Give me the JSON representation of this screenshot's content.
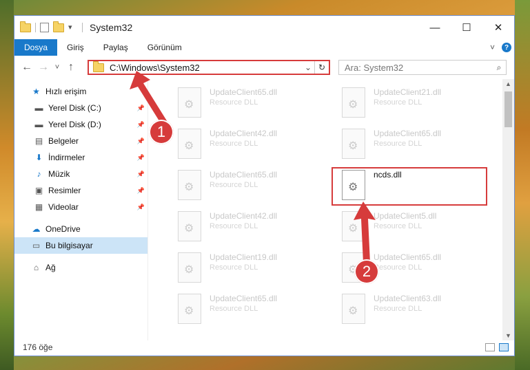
{
  "window": {
    "title": "System32",
    "controls": {
      "minimize": "—",
      "maximize": "☐",
      "close": "✕"
    }
  },
  "ribbon": {
    "tabs": [
      "Dosya",
      "Giriş",
      "Paylaş",
      "Görünüm"
    ],
    "active_tab": "Dosya"
  },
  "nav": {
    "back": "←",
    "forward": "→",
    "recent": "˅",
    "up": "↑",
    "address": "C:\\Windows\\System32",
    "search_placeholder": "Ara: System32"
  },
  "sidebar": {
    "items": [
      {
        "label": "Hızlı erişim",
        "icon": "star-icon",
        "glyph": "★",
        "pinned": false,
        "indent": 0
      },
      {
        "label": "Yerel Disk (C:)",
        "icon": "drive-icon",
        "glyph": "▬",
        "pinned": true,
        "indent": 1
      },
      {
        "label": "Yerel Disk (D:)",
        "icon": "drive-icon",
        "glyph": "▬",
        "pinned": true,
        "indent": 1
      },
      {
        "label": "Belgeler",
        "icon": "documents-icon",
        "glyph": "▤",
        "pinned": true,
        "indent": 1
      },
      {
        "label": "İndirmeler",
        "icon": "download-icon",
        "glyph": "⬇",
        "pinned": true,
        "indent": 1
      },
      {
        "label": "Müzik",
        "icon": "music-icon",
        "glyph": "♪",
        "pinned": true,
        "indent": 1
      },
      {
        "label": "Resimler",
        "icon": "pictures-icon",
        "glyph": "▣",
        "pinned": true,
        "indent": 1
      },
      {
        "label": "Videolar",
        "icon": "video-icon",
        "glyph": "▦",
        "pinned": true,
        "indent": 1
      },
      {
        "label": "OneDrive",
        "icon": "cloud-icon",
        "glyph": "☁",
        "pinned": false,
        "indent": 0
      },
      {
        "label": "Bu bilgisayar",
        "icon": "computer-icon",
        "glyph": "▭",
        "pinned": false,
        "indent": 0,
        "selected": true
      },
      {
        "label": "Ağ",
        "icon": "network-icon",
        "glyph": "⌂",
        "pinned": false,
        "indent": 0
      }
    ]
  },
  "files": [
    {
      "name": "UpdateClient65.dll",
      "type": "Resource DLL"
    },
    {
      "name": "UpdateClient21.dll",
      "type": "Resource DLL"
    },
    {
      "name": "UpdateClient42.dll",
      "type": "Resource DLL"
    },
    {
      "name": "UpdateClient65.dll",
      "type": "Resource DLL"
    },
    {
      "name": "UpdateClient65.dll",
      "type": "Resource DLL"
    },
    {
      "name": "ncds.dll",
      "type": "",
      "highlighted": true
    },
    {
      "name": "UpdateClient42.dll",
      "type": "Resource DLL"
    },
    {
      "name": "UpdateClient5.dll",
      "type": "Resource DLL"
    },
    {
      "name": "UpdateClient19.dll",
      "type": "Resource DLL"
    },
    {
      "name": "UpdateClient65.dll",
      "type": "Resource DLL"
    },
    {
      "name": "UpdateClient65.dll",
      "type": "Resource DLL"
    },
    {
      "name": "UpdateClient63.dll",
      "type": "Resource DLL"
    }
  ],
  "status": {
    "item_count": "176 öğe"
  },
  "markers": [
    "1",
    "2"
  ],
  "colors": {
    "accent": "#1979ca",
    "highlight": "#d63b3b"
  }
}
